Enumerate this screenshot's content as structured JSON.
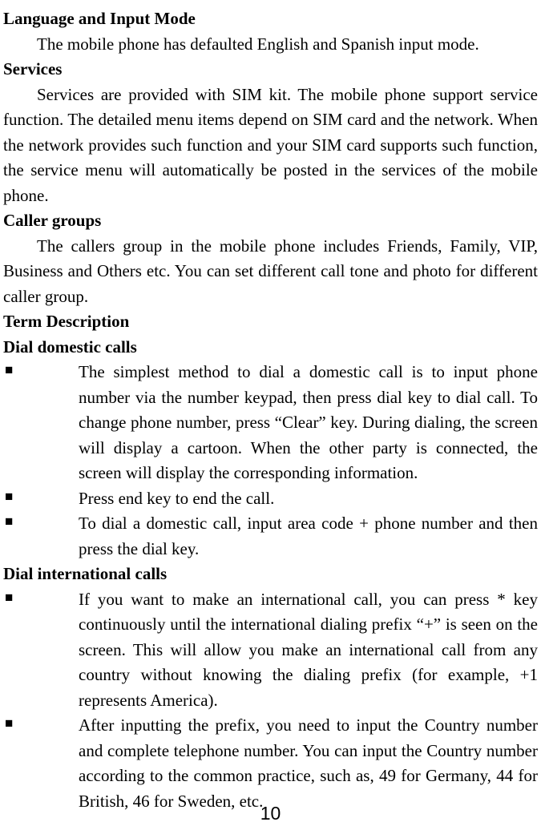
{
  "sections": {
    "lang_input": {
      "heading": "Language and Input Mode",
      "text": "The mobile phone has defaulted English and Spanish input mode."
    },
    "services": {
      "heading": "Services",
      "text": "Services are provided with SIM kit. The mobile phone support service function. The detailed menu items depend on SIM card and the network. When the network provides such function and your SIM card supports such function, the service menu will automatically be posted in the services of the mobile phone."
    },
    "caller_groups": {
      "heading": "Caller groups",
      "text": "The callers group in the mobile phone includes Friends, Family, VIP, Business and Others etc. You can set different call tone and photo for different caller group."
    },
    "term_desc": {
      "heading": "Term Description"
    },
    "domestic": {
      "heading": "Dial domestic calls",
      "items": [
        "The simplest method to dial a domestic call is to input phone number via the number keypad, then press dial key to dial call. To change phone number, press “Clear” key. During dialing, the screen will display a cartoon. When the other party is connected, the screen will display the corresponding information.",
        "Press end key to end the call.",
        "To dial a domestic call, input area code + phone number and then press the dial key."
      ]
    },
    "international": {
      "heading": "Dial international calls",
      "items": [
        "If you want to make an international call, you can press * key continuously until the international dialing prefix “+” is seen on the screen. This will allow you make an international call from any country without knowing the dialing prefix (for example, +1 represents America).",
        "After inputting the prefix, you need to input the Country number and complete telephone number. You can input the Country number according to the common practice, such as, 49 for Germany, 44 for British, 46 for Sweden, etc."
      ]
    }
  },
  "bullet_marker": "■",
  "page_number": "10"
}
